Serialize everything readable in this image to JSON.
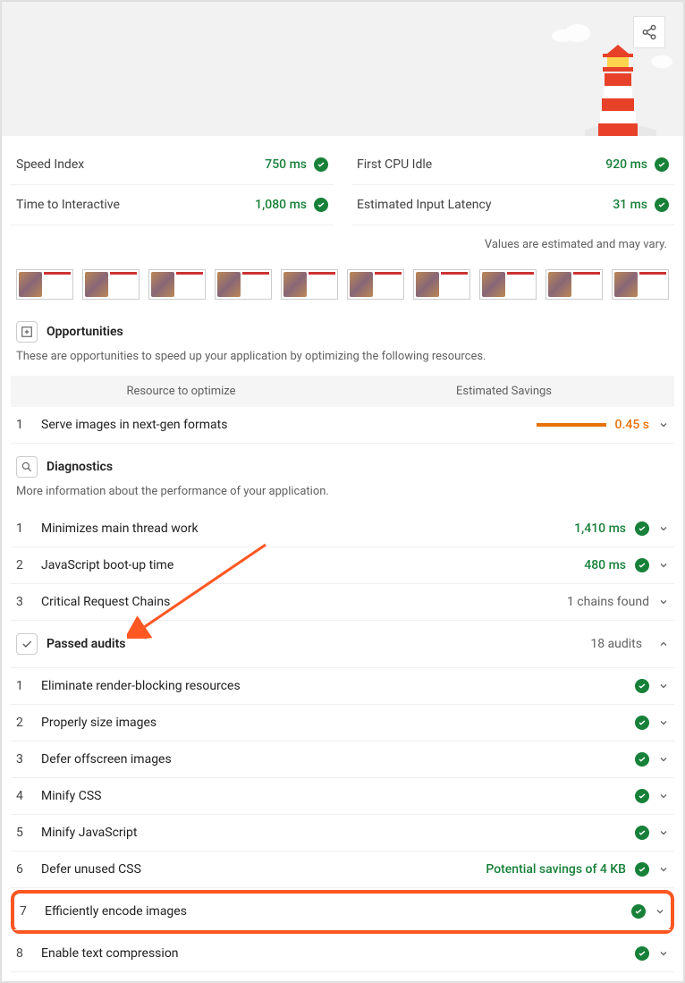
{
  "metrics": {
    "left": [
      {
        "label": "Speed Index",
        "value": "750 ms"
      },
      {
        "label": "Time to Interactive",
        "value": "1,080 ms"
      }
    ],
    "right": [
      {
        "label": "First CPU Idle",
        "value": "920 ms"
      },
      {
        "label": "Estimated Input Latency",
        "value": "31 ms"
      }
    ],
    "note": "Values are estimated and may vary."
  },
  "opportunities": {
    "title": "Opportunities",
    "desc": "These are opportunities to speed up your application by optimizing the following resources.",
    "col1": "Resource to optimize",
    "col2": "Estimated Savings",
    "items": [
      {
        "n": "1",
        "label": "Serve images in next-gen formats",
        "savings": "0.45 s"
      }
    ]
  },
  "diagnostics": {
    "title": "Diagnostics",
    "desc": "More information about the performance of your application.",
    "items": [
      {
        "n": "1",
        "label": "Minimizes main thread work",
        "value": "1,410 ms",
        "pass": true
      },
      {
        "n": "2",
        "label": "JavaScript boot-up time",
        "value": "480 ms",
        "pass": true
      },
      {
        "n": "3",
        "label": "Critical Request Chains",
        "value": "1 chains found",
        "pass": false
      }
    ]
  },
  "passed": {
    "title": "Passed audits",
    "count": "18 audits",
    "items": [
      {
        "n": "1",
        "label": "Eliminate render-blocking resources"
      },
      {
        "n": "2",
        "label": "Properly size images"
      },
      {
        "n": "3",
        "label": "Defer offscreen images"
      },
      {
        "n": "4",
        "label": "Minify CSS"
      },
      {
        "n": "5",
        "label": "Minify JavaScript"
      },
      {
        "n": "6",
        "label": "Defer unused CSS",
        "extra": "Potential savings of 4 KB"
      },
      {
        "n": "7",
        "label": "Efficiently encode images",
        "highlight": true
      },
      {
        "n": "8",
        "label": "Enable text compression"
      }
    ]
  }
}
